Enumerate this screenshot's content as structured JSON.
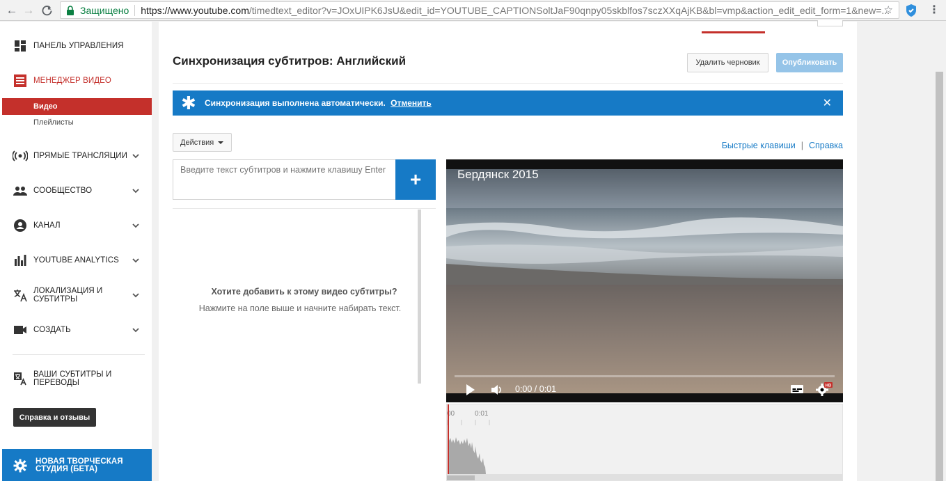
{
  "browser": {
    "secure_label": "Защищено",
    "url_host": "https://www.youtube.com",
    "url_rest": "/timedtext_editor?v=JOxUIPK6JsU&edit_id=YOUTUBE_CAPTIONSoltJaF90qnpy05skblfos7sczXXqAjKB&bl=vmp&action_edit_edit_form=1&new=..."
  },
  "sidebar": {
    "dashboard": "ПАНЕЛЬ УПРАВЛЕНИЯ",
    "video_manager": "МЕНЕДЖЕР ВИДЕО",
    "sub_videos": "Видео",
    "sub_playlists": "Плейлисты",
    "live": "ПРЯМЫЕ ТРАНСЛЯЦИИ",
    "community": "СООБЩЕСТВО",
    "channel": "КАНАЛ",
    "analytics": "YOUTUBE ANALYTICS",
    "localization": "ЛОКАЛИЗАЦИЯ И СУБТИТРЫ",
    "create": "СОЗДАТЬ",
    "your_subtitles": "ВАШИ СУБТИТРЫ И ПЕРЕВОДЫ",
    "help_button": "Справка и отзывы",
    "new_studio": "НОВАЯ ТВОРЧЕСКАЯ СТУДИЯ (БЕТА)"
  },
  "main": {
    "title": "Синхронизация субтитров: Английский",
    "delete_draft": "Удалить черновик",
    "publish": "Опубликовать",
    "banner_text": "Синхронизация выполнена автоматически.",
    "banner_link": "Отменить",
    "actions": "Действия",
    "shortcuts_link": "Быстрые клавиши",
    "help_link": "Справка",
    "link_separator": "|",
    "input_placeholder": "Введите текст субтитров и нажмите клавишу Enter",
    "add_symbol": "+",
    "empty_title": "Хотите добавить к этому видео субтитры?",
    "empty_sub": "Нажмите на поле выше и начните набирать текст."
  },
  "player": {
    "video_title": "Бердянск 2015",
    "time": "0:00 / 0:01",
    "progress": 0,
    "hd_badge": "HD"
  },
  "timeline": {
    "tick_0": "00",
    "tick_1": "0:01"
  },
  "colors": {
    "accent_red": "#c4302b",
    "accent_blue": "#167ac6",
    "secure_green": "#0b8043"
  }
}
